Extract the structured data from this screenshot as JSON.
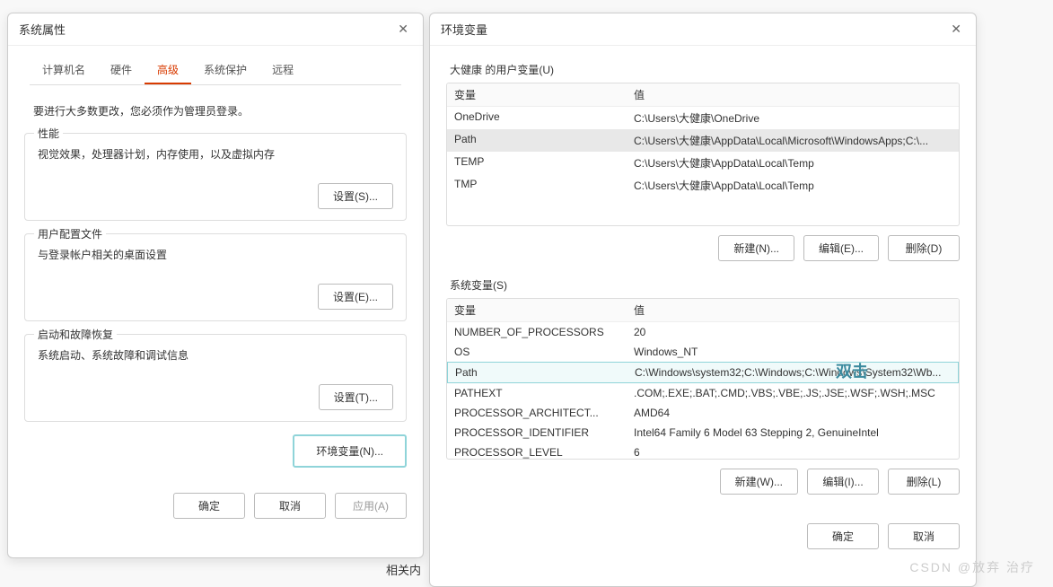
{
  "sysprops": {
    "title": "系统属性",
    "tabs": [
      "计算机名",
      "硬件",
      "高级",
      "系统保护",
      "远程"
    ],
    "activeTab": 2,
    "adminNote": "要进行大多数更改，您必须作为管理员登录。",
    "perf": {
      "label": "性能",
      "desc": "视觉效果，处理器计划，内存使用，以及虚拟内存",
      "btn": "设置(S)..."
    },
    "profile": {
      "label": "用户配置文件",
      "desc": "与登录帐户相关的桌面设置",
      "btn": "设置(E)..."
    },
    "startup": {
      "label": "启动和故障恢复",
      "desc": "系统启动、系统故障和调试信息",
      "btn": "设置(T)..."
    },
    "envBtn": "环境变量(N)...",
    "ok": "确定",
    "cancel": "取消",
    "apply": "应用(A)"
  },
  "envvars": {
    "title": "环境变量",
    "userSection": "大健康 的用户变量(U)",
    "sysSection": "系统变量(S)",
    "colVar": "变量",
    "colVal": "值",
    "userVars": [
      {
        "name": "OneDrive",
        "value": "C:\\Users\\大健康\\OneDrive"
      },
      {
        "name": "Path",
        "value": "C:\\Users\\大健康\\AppData\\Local\\Microsoft\\WindowsApps;C:\\..."
      },
      {
        "name": "TEMP",
        "value": "C:\\Users\\大健康\\AppData\\Local\\Temp"
      },
      {
        "name": "TMP",
        "value": "C:\\Users\\大健康\\AppData\\Local\\Temp"
      }
    ],
    "userSelected": 1,
    "sysVars": [
      {
        "name": "NUMBER_OF_PROCESSORS",
        "value": "20"
      },
      {
        "name": "OS",
        "value": "Windows_NT"
      },
      {
        "name": "Path",
        "value": "C:\\Windows\\system32;C:\\Windows;C:\\Windows\\System32\\Wb..."
      },
      {
        "name": "PATHEXT",
        "value": ".COM;.EXE;.BAT;.CMD;.VBS;.VBE;.JS;.JSE;.WSF;.WSH;.MSC"
      },
      {
        "name": "PROCESSOR_ARCHITECT...",
        "value": "AMD64"
      },
      {
        "name": "PROCESSOR_IDENTIFIER",
        "value": "Intel64 Family 6 Model 63 Stepping 2, GenuineIntel"
      },
      {
        "name": "PROCESSOR_LEVEL",
        "value": "6"
      }
    ],
    "sysHighlighted": 2,
    "newBtn1": "新建(N)...",
    "editBtn1": "编辑(E)...",
    "delBtn1": "删除(D)",
    "newBtn2": "新建(W)...",
    "editBtn2": "编辑(I)...",
    "delBtn2": "删除(L)",
    "ok": "确定",
    "cancel": "取消"
  },
  "annotation": "双击",
  "footerText": "相关内",
  "watermark": "CSDN @放弃     治疗"
}
